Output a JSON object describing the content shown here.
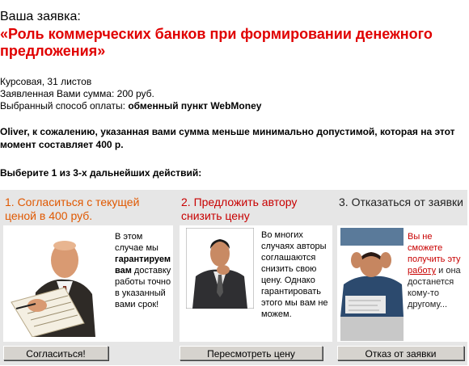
{
  "order": {
    "heading": "Ваша заявка:",
    "title": "«Роль коммерческих банков при формировании денежного предложения»",
    "work_type": "Курсовая, 31 листов",
    "amount_label": "Заявленная Вами сумма:",
    "amount_value": "200 руб.",
    "payment_label": "Выбранный способ оплаты:",
    "payment_value": "обменный пункт WebMoney"
  },
  "warning": "Oliver, к сожалению, указанная вами сумма меньше минимально допустимой, которая на этот момент составляет 400 р.",
  "choose_prompt": "Выберите 1 из 3-х дальнейших действий:",
  "options": [
    {
      "heading": "1. Согласиться с текущей ценой в 400 руб.",
      "text_before": "В этом случае мы ",
      "text_bold": "гарантируем вам",
      "text_after": " доставку работы точно в указанный вами срок!",
      "button": "Согласиться!"
    },
    {
      "heading": "2. Предложить автору снизить цену",
      "text": "Во многих случаях авторы соглашаются снизить свою цену. Однако гарантировать этого мы вам не можем.",
      "button": "Пересмотреть цену"
    },
    {
      "heading": "3. Отказаться от заявки",
      "text_red": "Вы не сможете получить эту ",
      "text_link": "работу",
      "text_dark": " и она достанется кому-то другому...",
      "button": "Отказ от заявки"
    }
  ]
}
